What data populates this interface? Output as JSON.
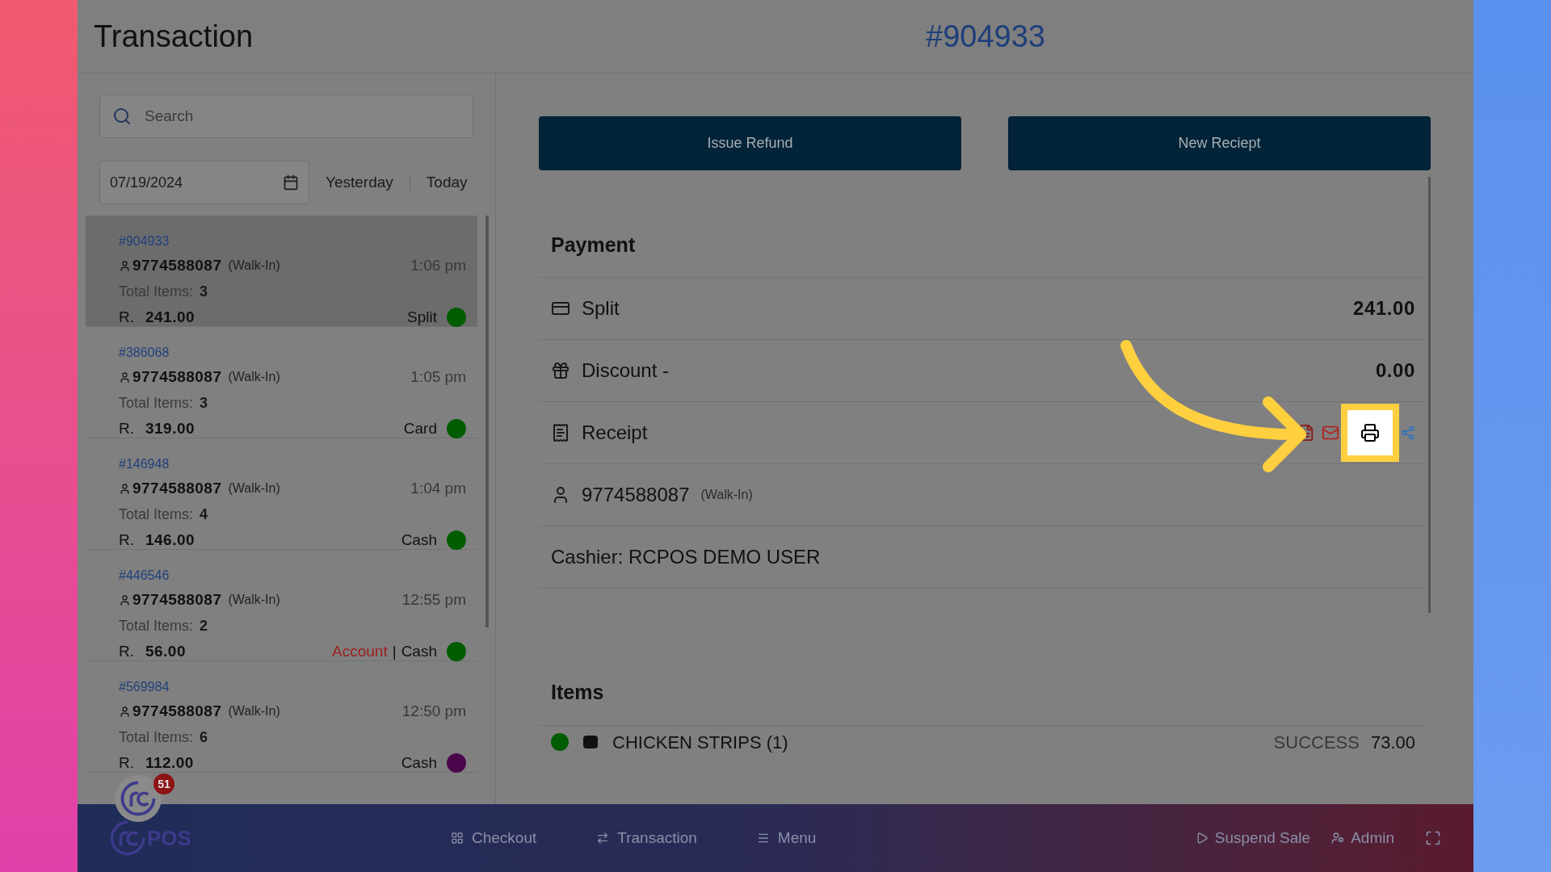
{
  "header": {
    "title": "Transaction",
    "transaction_number": "#904933"
  },
  "search": {
    "placeholder": "Search"
  },
  "date_filter": {
    "value": "07/19/2024",
    "quick_links": [
      "Yesterday",
      "Today"
    ]
  },
  "transactions": [
    {
      "number": "#904933",
      "phone": "9774588087",
      "customer_type": "(Walk-In)",
      "time": "1:06 pm",
      "items_label": "Total Items:",
      "items": "3",
      "currency": "R.",
      "amount": "241.00",
      "methods": [
        {
          "label": "Split",
          "kind": "plain"
        }
      ],
      "color": "#005c00",
      "selected": true
    },
    {
      "number": "#386068",
      "phone": "9774588087",
      "customer_type": "(Walk-In)",
      "time": "1:05 pm",
      "items_label": "Total Items:",
      "items": "3",
      "currency": "R.",
      "amount": "319.00",
      "methods": [
        {
          "label": "Card",
          "kind": "plain"
        }
      ],
      "color": "#005c00",
      "selected": false
    },
    {
      "number": "#146948",
      "phone": "9774588087",
      "customer_type": "(Walk-In)",
      "time": "1:04 pm",
      "items_label": "Total Items:",
      "items": "4",
      "currency": "R.",
      "amount": "146.00",
      "methods": [
        {
          "label": "Cash",
          "kind": "plain"
        }
      ],
      "color": "#005c00",
      "selected": false
    },
    {
      "number": "#446546",
      "phone": "9774588087",
      "customer_type": "(Walk-In)",
      "time": "12:55 pm",
      "items_label": "Total Items:",
      "items": "2",
      "currency": "R.",
      "amount": "56.00",
      "methods": [
        {
          "label": "Account",
          "kind": "account"
        },
        {
          "label": "Cash",
          "kind": "plain"
        }
      ],
      "separator": "|",
      "color": "#005c00",
      "selected": false
    },
    {
      "number": "#569984",
      "phone": "9774588087",
      "customer_type": "(Walk-In)",
      "time": "12:50 pm",
      "items_label": "Total Items:",
      "items": "6",
      "currency": "R.",
      "amount": "112.00",
      "methods": [
        {
          "label": "Cash",
          "kind": "plain"
        }
      ],
      "color": "#4a064a",
      "selected": false
    }
  ],
  "actions": [
    "Issue Refund",
    "New Reciept"
  ],
  "payment": {
    "title": "Payment",
    "rows": [
      {
        "kind": "card",
        "label": "Split",
        "value": "241.00"
      },
      {
        "kind": "gift",
        "label": "Discount -",
        "value": "0.00"
      },
      {
        "kind": "receipt",
        "label": "Receipt"
      },
      {
        "kind": "customer",
        "label": "9774588087",
        "note": "(Walk-In)"
      },
      {
        "kind": "cashier",
        "label": "Cashier: RCPOS DEMO USER"
      }
    ]
  },
  "items": {
    "title": "Items",
    "rows": [
      {
        "color": "#005c00",
        "name": "CHICKEN STRIPS (1)",
        "status": "SUCCESS",
        "amount": "73.00"
      }
    ]
  },
  "bottom_bar": {
    "logo": "POS",
    "badge": "51",
    "nav": [
      "Checkout",
      "Transaction",
      "Menu"
    ],
    "right": [
      "Suspend Sale",
      "Admin"
    ]
  }
}
